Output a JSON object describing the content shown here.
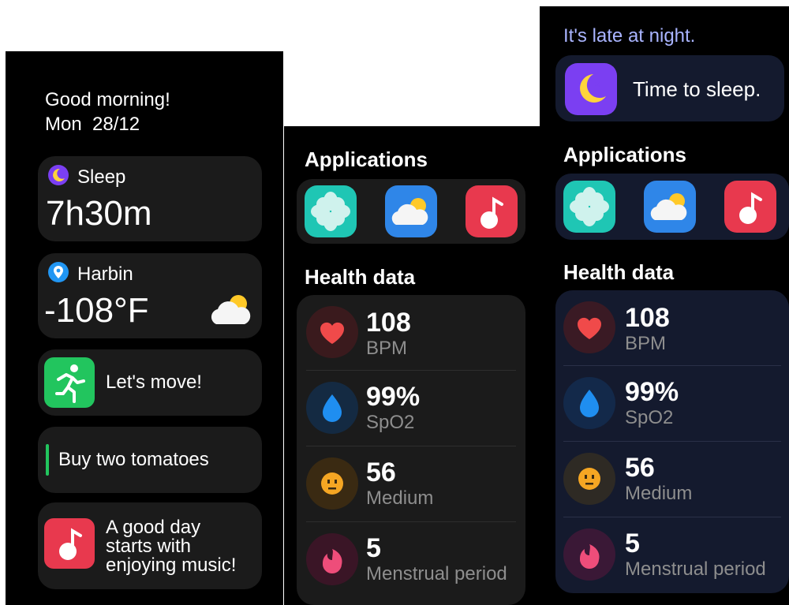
{
  "screen1": {
    "greeting": "Good morning!",
    "date": "Mon  28/12",
    "sleep": {
      "label": "Sleep",
      "value": "7h30m"
    },
    "weather": {
      "city": "Harbin",
      "temp": "-108°F"
    },
    "move_label": "Let's move!",
    "todo_text": "Buy two tomatoes",
    "music_lines": [
      "A good day",
      "starts with",
      "enjoying music!"
    ]
  },
  "screen2": {
    "applications_title": "Applications",
    "health_title": "Health data",
    "health": [
      {
        "value": "108",
        "unit": "BPM",
        "icon": "heart-icon"
      },
      {
        "value": "99%",
        "unit": "SpO2",
        "icon": "water-drop-icon"
      },
      {
        "value": "56",
        "unit": "Medium",
        "icon": "stress-face-icon"
      },
      {
        "value": "5",
        "unit": "Menstrual period",
        "icon": "menstrual-icon"
      }
    ]
  },
  "screen3": {
    "night_text": "It's late at night.",
    "sleep_reminder": "Time to sleep.",
    "applications_title": "Applications",
    "health_title": "Health data",
    "health": [
      {
        "value": "108",
        "unit": "BPM"
      },
      {
        "value": "99%",
        "unit": "SpO2"
      },
      {
        "value": "56",
        "unit": "Medium"
      },
      {
        "value": "5",
        "unit": "Menstrual period"
      }
    ]
  },
  "colors": {
    "night_text": "#a9b4ff",
    "card_dark": "#1b1b1b",
    "card_navy": "#141a2e",
    "unit_gray": "#8e8e8e",
    "heart_red": "#f04a4a",
    "drop_blue": "#1f8ef0",
    "face_orange": "#f5a623",
    "menstrual_pink": "#ee4d7a",
    "move_green": "#22c55e",
    "music_red": "#e8394e",
    "sleep_purple": "#7b3ff2"
  }
}
